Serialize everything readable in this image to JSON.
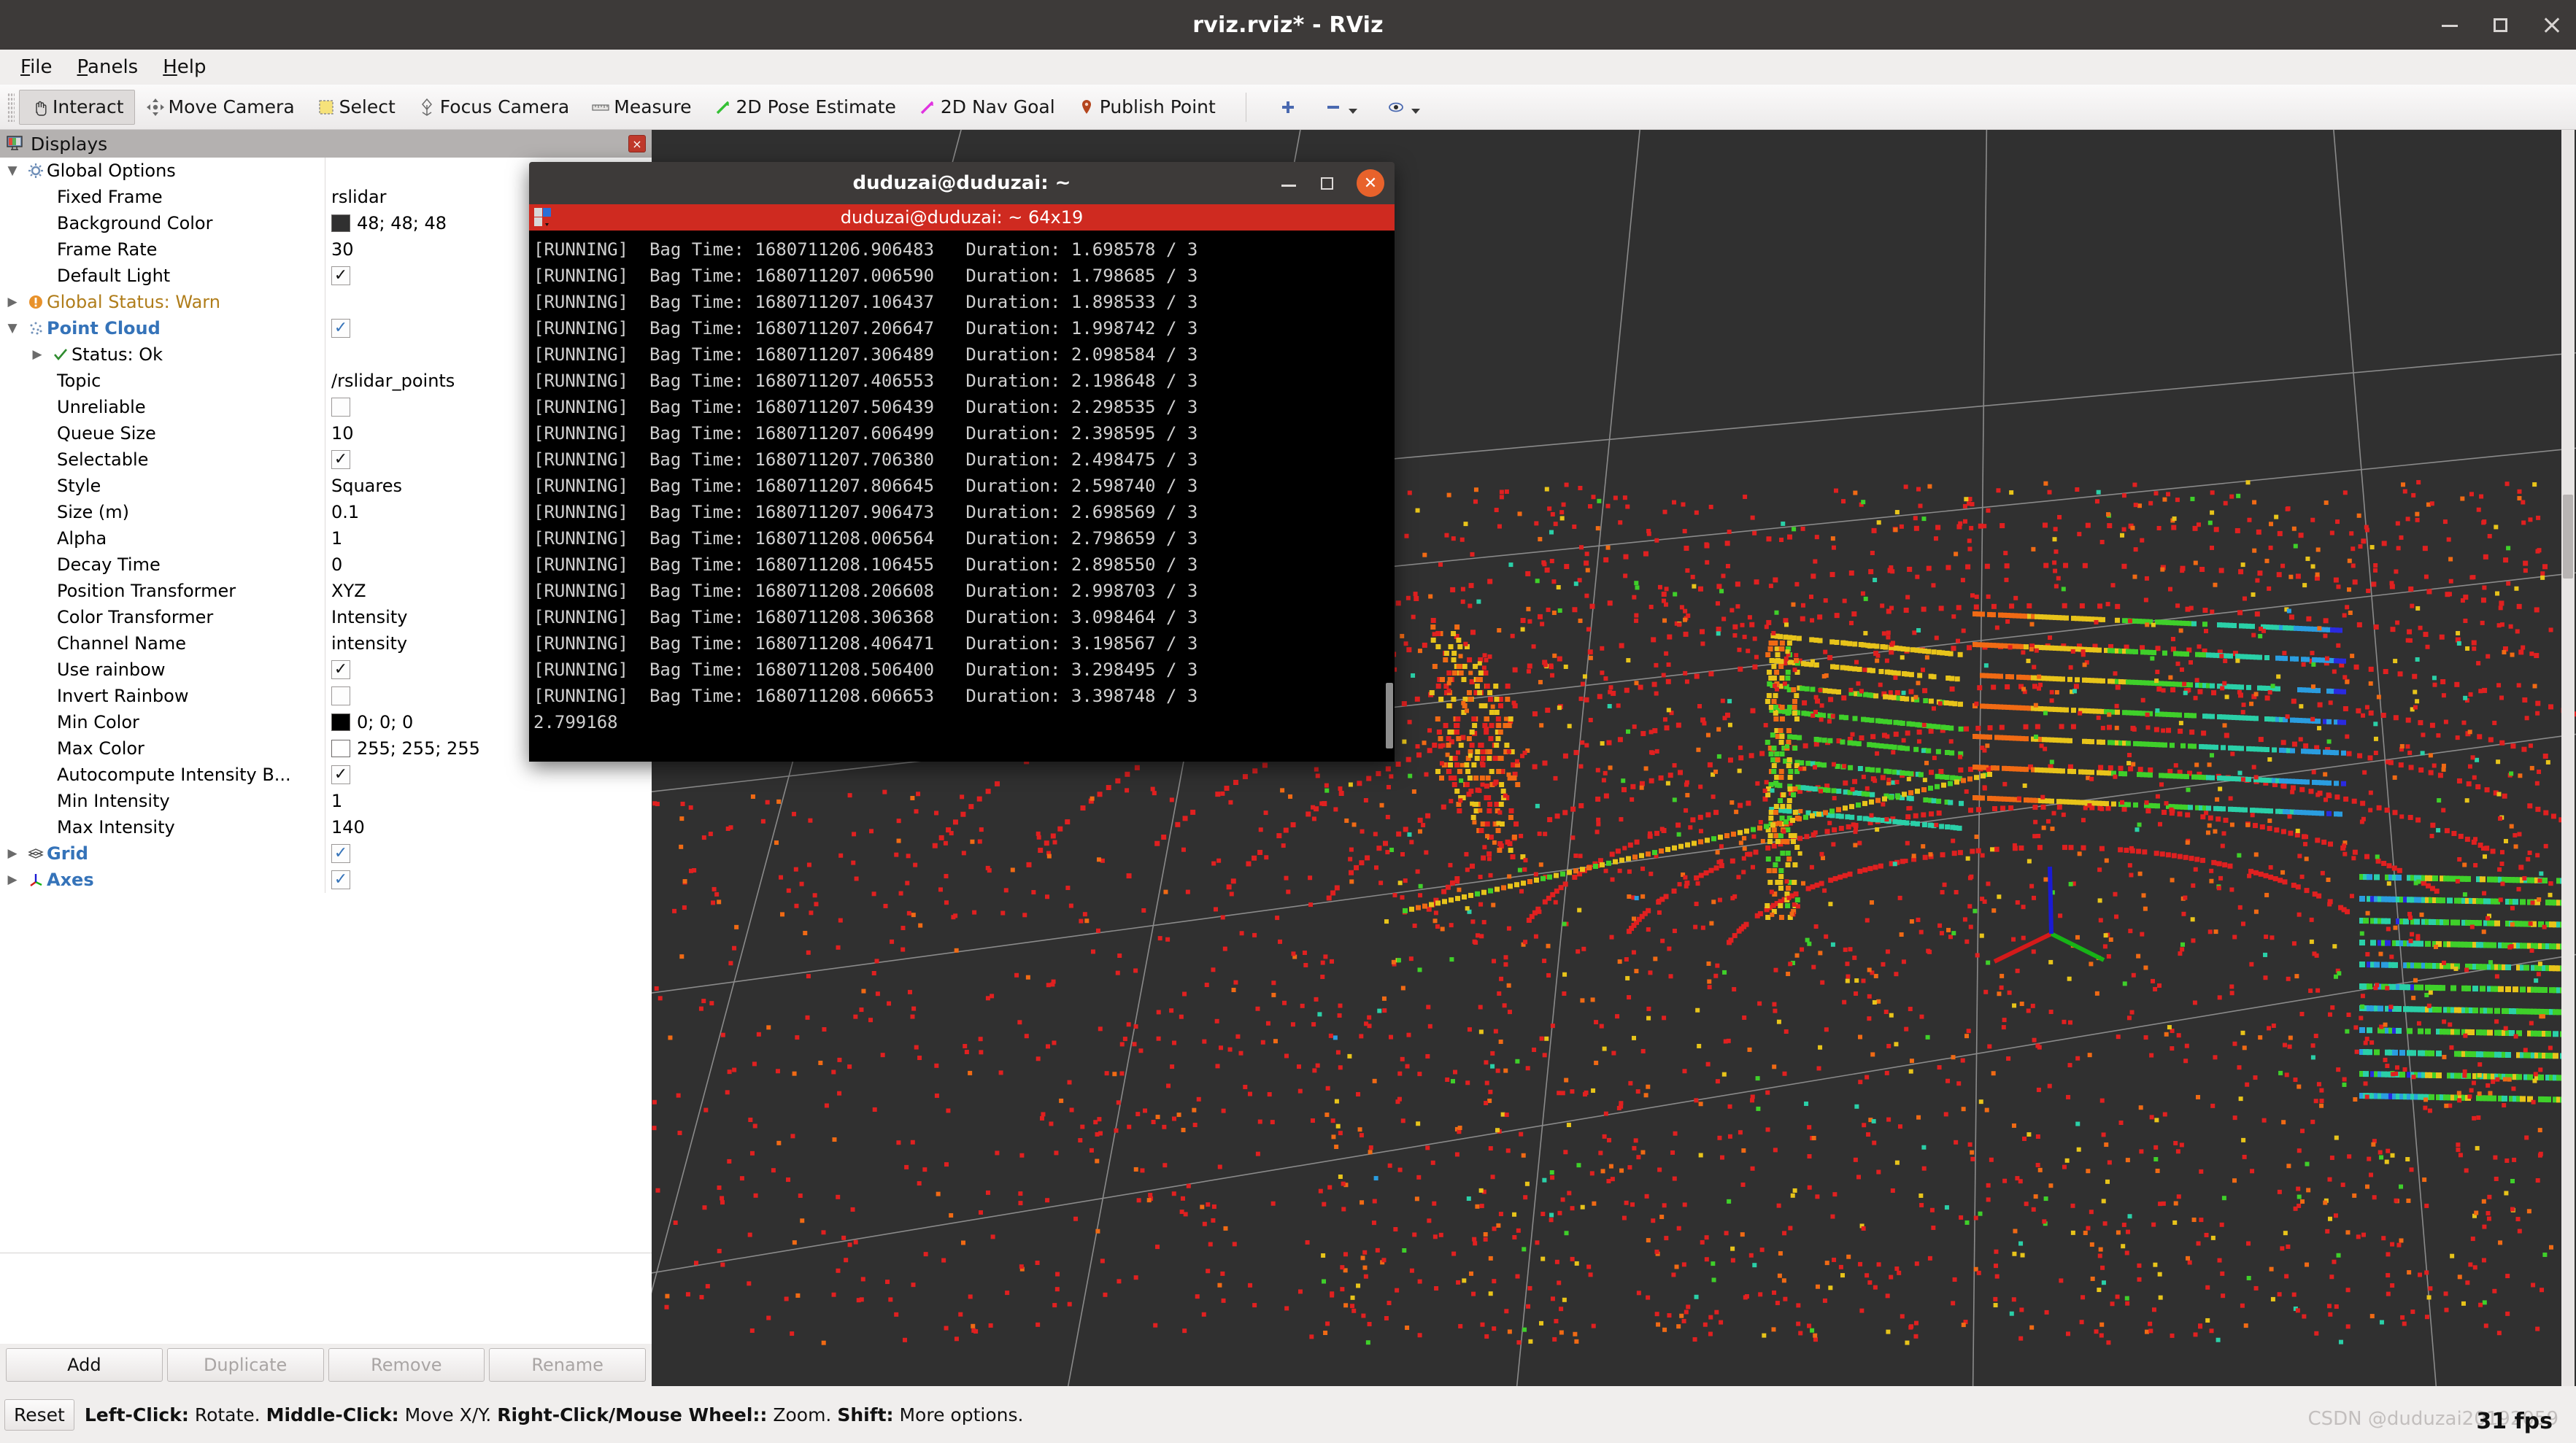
{
  "window": {
    "title": "rviz.rviz* - RViz",
    "minimize_label": "minimize",
    "maximize_label": "maximize",
    "close_label": "close"
  },
  "menubar": {
    "items": [
      {
        "label": "File",
        "accel": "F"
      },
      {
        "label": "Panels",
        "accel": "P"
      },
      {
        "label": "Help",
        "accel": "H"
      }
    ]
  },
  "toolbar": {
    "tools": [
      {
        "label": "Interact",
        "icon": "hand-cursor-icon",
        "active": true
      },
      {
        "label": "Move Camera",
        "icon": "move-camera-icon",
        "active": false
      },
      {
        "label": "Select",
        "icon": "select-rect-icon",
        "active": false
      },
      {
        "label": "Focus Camera",
        "icon": "focus-camera-icon",
        "active": false
      },
      {
        "label": "Measure",
        "icon": "ruler-icon",
        "active": false
      },
      {
        "label": "2D Pose Estimate",
        "icon": "green-arrow-icon",
        "active": false
      },
      {
        "label": "2D Nav Goal",
        "icon": "magenta-arrow-icon",
        "active": false
      },
      {
        "label": "Publish Point",
        "icon": "map-pin-icon",
        "active": false
      }
    ],
    "extra_buttons": [
      {
        "icon": "plus-icon",
        "label": ""
      },
      {
        "icon": "minus-icon",
        "label": "",
        "has_dropdown": true
      },
      {
        "icon": "eye-icon",
        "label": "",
        "has_dropdown": true
      }
    ]
  },
  "displays_panel": {
    "title": "Displays",
    "icon": "monitor-icon",
    "close_label": "×",
    "rows": [
      {
        "name": "Global Options",
        "value": "",
        "kind": "group",
        "icon": "gear-icon",
        "expanded": true,
        "indent": 1
      },
      {
        "name": "Fixed Frame",
        "value": "rslidar",
        "kind": "text",
        "indent": 2
      },
      {
        "name": "Background Color",
        "value": "48; 48; 48",
        "kind": "color",
        "color": "#303030",
        "indent": 2
      },
      {
        "name": "Frame Rate",
        "value": "30",
        "kind": "text",
        "indent": 2
      },
      {
        "name": "Default Light",
        "value": "",
        "kind": "check",
        "checked": true,
        "indent": 2
      },
      {
        "name": "Global Status: Warn",
        "value": "",
        "kind": "status-warn",
        "icon": "warning-icon",
        "expanded": false,
        "indent": 1
      },
      {
        "name": "Point Cloud",
        "value": "",
        "kind": "display",
        "icon": "pointcloud-icon",
        "expanded": true,
        "checked": true,
        "indent": 1
      },
      {
        "name": "Status: Ok",
        "value": "",
        "kind": "status-ok",
        "icon": "check-icon",
        "expanded": false,
        "indent": 3
      },
      {
        "name": "Topic",
        "value": "/rslidar_points",
        "kind": "text",
        "indent": 2
      },
      {
        "name": "Unreliable",
        "value": "",
        "kind": "check",
        "checked": false,
        "indent": 2
      },
      {
        "name": "Queue Size",
        "value": "10",
        "kind": "text",
        "indent": 2
      },
      {
        "name": "Selectable",
        "value": "",
        "kind": "check",
        "checked": true,
        "indent": 2
      },
      {
        "name": "Style",
        "value": "Squares",
        "kind": "text",
        "indent": 2
      },
      {
        "name": "Size (m)",
        "value": "0.1",
        "kind": "text",
        "indent": 2
      },
      {
        "name": "Alpha",
        "value": "1",
        "kind": "text",
        "indent": 2
      },
      {
        "name": "Decay Time",
        "value": "0",
        "kind": "text",
        "indent": 2
      },
      {
        "name": "Position Transformer",
        "value": "XYZ",
        "kind": "text",
        "indent": 2
      },
      {
        "name": "Color Transformer",
        "value": "Intensity",
        "kind": "text",
        "indent": 2
      },
      {
        "name": "Channel Name",
        "value": "intensity",
        "kind": "text",
        "indent": 2
      },
      {
        "name": "Use rainbow",
        "value": "",
        "kind": "check",
        "checked": true,
        "indent": 2
      },
      {
        "name": "Invert Rainbow",
        "value": "",
        "kind": "check",
        "checked": false,
        "indent": 2
      },
      {
        "name": "Min Color",
        "value": "0; 0; 0",
        "kind": "color",
        "color": "#000000",
        "indent": 2
      },
      {
        "name": "Max Color",
        "value": "255; 255; 255",
        "kind": "color",
        "color": "#ffffff",
        "indent": 2
      },
      {
        "name": "Autocompute Intensity B...",
        "value": "",
        "kind": "check",
        "checked": true,
        "indent": 2
      },
      {
        "name": "Min Intensity",
        "value": "1",
        "kind": "text",
        "indent": 2
      },
      {
        "name": "Max Intensity",
        "value": "140",
        "kind": "text",
        "indent": 2
      },
      {
        "name": "Grid",
        "value": "",
        "kind": "display",
        "icon": "grid-icon",
        "expanded": false,
        "checked": true,
        "indent": 1
      },
      {
        "name": "Axes",
        "value": "",
        "kind": "display",
        "icon": "axes-icon",
        "expanded": false,
        "checked": true,
        "indent": 1
      }
    ],
    "buttons": [
      {
        "label": "Add",
        "enabled": true
      },
      {
        "label": "Duplicate",
        "enabled": false
      },
      {
        "label": "Remove",
        "enabled": false
      },
      {
        "label": "Rename",
        "enabled": false
      }
    ]
  },
  "terminal": {
    "title": "duduzai@duduzai: ~",
    "tab_label": "duduzai@duduzai: ~ 64x19",
    "tab_icon": "terminal-tab-icon",
    "minimize_label": "minimize",
    "maximize_label": "maximize",
    "close_label": "✕",
    "lines": [
      "[RUNNING]  Bag Time: 1680711206.906483   Duration: 1.698578 / 3",
      "[RUNNING]  Bag Time: 1680711207.006590   Duration: 1.798685 / 3",
      "[RUNNING]  Bag Time: 1680711207.106437   Duration: 1.898533 / 3",
      "[RUNNING]  Bag Time: 1680711207.206647   Duration: 1.998742 / 3",
      "[RUNNING]  Bag Time: 1680711207.306489   Duration: 2.098584 / 3",
      "[RUNNING]  Bag Time: 1680711207.406553   Duration: 2.198648 / 3",
      "[RUNNING]  Bag Time: 1680711207.506439   Duration: 2.298535 / 3",
      "[RUNNING]  Bag Time: 1680711207.606499   Duration: 2.398595 / 3",
      "[RUNNING]  Bag Time: 1680711207.706380   Duration: 2.498475 / 3",
      "[RUNNING]  Bag Time: 1680711207.806645   Duration: 2.598740 / 3",
      "[RUNNING]  Bag Time: 1680711207.906473   Duration: 2.698569 / 3",
      "[RUNNING]  Bag Time: 1680711208.006564   Duration: 2.798659 / 3",
      "[RUNNING]  Bag Time: 1680711208.106455   Duration: 2.898550 / 3",
      "[RUNNING]  Bag Time: 1680711208.206608   Duration: 2.998703 / 3",
      "[RUNNING]  Bag Time: 1680711208.306368   Duration: 3.098464 / 3",
      "[RUNNING]  Bag Time: 1680711208.406471   Duration: 3.198567 / 3",
      "[RUNNING]  Bag Time: 1680711208.506400   Duration: 3.298495 / 3",
      "[RUNNING]  Bag Time: 1680711208.606653   Duration: 3.398748 / 3",
      "2.799168"
    ]
  },
  "statusbar": {
    "reset_label": "Reset",
    "hint_segments": [
      {
        "text": "Left-Click:",
        "bold": true
      },
      {
        "text": " Rotate. ",
        "bold": false
      },
      {
        "text": "Middle-Click:",
        "bold": true
      },
      {
        "text": " Move X/Y. ",
        "bold": false
      },
      {
        "text": "Right-Click/Mouse Wheel::",
        "bold": true
      },
      {
        "text": " Zoom. ",
        "bold": false
      },
      {
        "text": "Shift:",
        "bold": true
      },
      {
        "text": " More options.",
        "bold": false
      }
    ],
    "fps": "31 fps",
    "watermark": "CSDN @duduzai20192059"
  },
  "viewport": {
    "background_color": "#303030",
    "grid_color": "#9a9a9a",
    "axes": {
      "x_color": "#d41a1a",
      "y_color": "#17b417",
      "z_color": "#1a1ad4"
    }
  }
}
